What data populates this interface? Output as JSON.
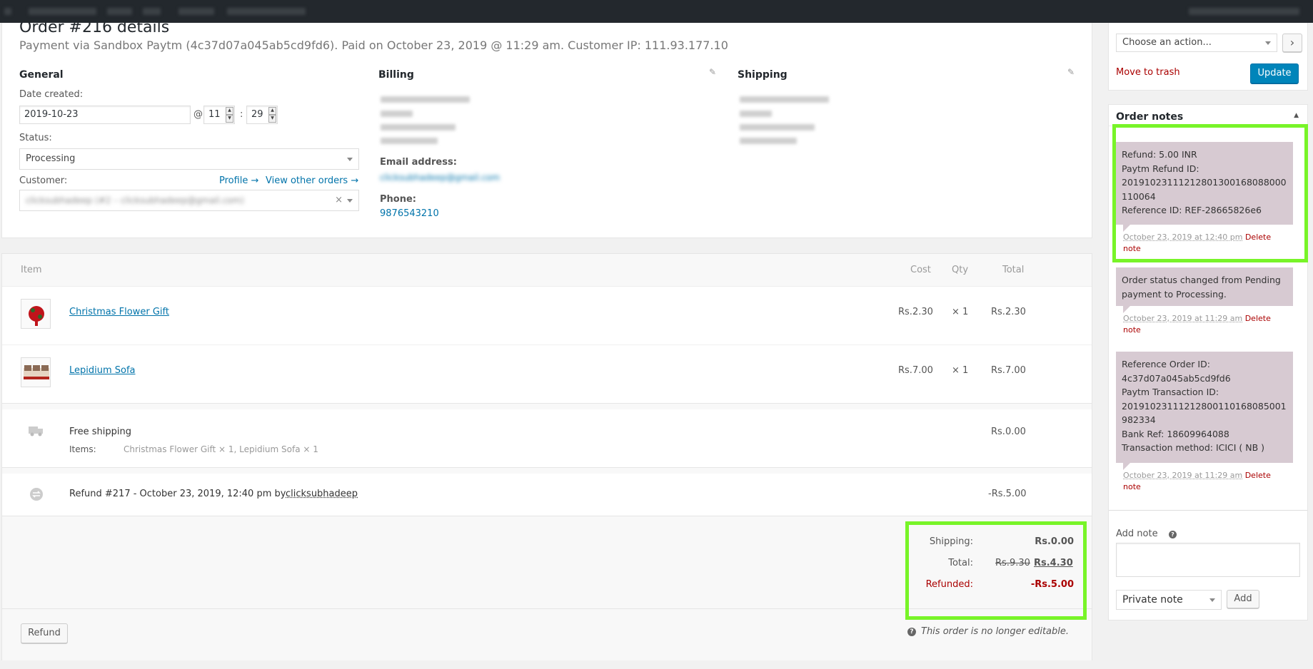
{
  "order": {
    "title": "Order #216 details",
    "subtitle": "Payment via Sandbox Paytm (4c37d07a045ab5cd9fd6). Paid on October 23, 2019 @ 11:29 am. Customer IP: 111.93.177.10"
  },
  "general": {
    "heading": "General",
    "date_label": "Date created:",
    "date_value": "2019-10-23",
    "at": "@",
    "hour": "11",
    "colon": ":",
    "minute": "29",
    "status_label": "Status:",
    "status_value": "Processing",
    "customer_label": "Customer:",
    "profile_link": "Profile →",
    "other_orders_link": "View other orders →",
    "customer_value": "clicksubhadeep (#2 – clicksubhadeep@gmail.com)"
  },
  "billing": {
    "heading": "Billing",
    "email_label": "Email address:",
    "email_value": "clicksubhadeep@gmail.com",
    "phone_label": "Phone:",
    "phone_value": "9876543210"
  },
  "shipping_col": {
    "heading": "Shipping"
  },
  "items": {
    "headers": {
      "item": "Item",
      "cost": "Cost",
      "qty": "Qty",
      "total": "Total"
    },
    "rows": [
      {
        "name": "Christmas Flower Gift",
        "cost": "Rs.2.30",
        "qty": "× 1",
        "total": "Rs.2.30"
      },
      {
        "name": "Lepidium Sofa",
        "cost": "Rs.7.00",
        "qty": "× 1",
        "total": "Rs.7.00"
      }
    ],
    "shipping": {
      "method": "Free shipping",
      "items_label": "Items:",
      "items_value": "Christmas Flower Gift × 1, Lepidium Sofa × 1",
      "total": "Rs.0.00"
    },
    "refund": {
      "text": "Refund #217 - October 23, 2019, 12:40 pm by",
      "user": "clicksubhadeep",
      "amount": "-Rs.5.00"
    }
  },
  "totals": {
    "shipping_label": "Shipping:",
    "shipping_value": "Rs.0.00",
    "total_label": "Total:",
    "total_old": "Rs.9.30",
    "total_new": "Rs.4.30",
    "refunded_label": "Refunded:",
    "refunded_value": "-Rs.5.00"
  },
  "footer": {
    "refund_button": "Refund",
    "not_editable": "This order is no longer editable."
  },
  "actions": {
    "select_value": "Choose an action...",
    "go": "›",
    "trash": "Move to trash",
    "update": "Update"
  },
  "notes": {
    "heading": "Order notes",
    "list": [
      {
        "lines": [
          "Refund: 5.00 INR",
          "Paytm Refund ID:",
          "20191023111212801300168088000",
          "110064",
          "Reference ID: REF-28665826e6"
        ],
        "date": "October 23, 2019 at 12:40 pm",
        "delete": "Delete",
        "delete2": "note"
      },
      {
        "lines": [
          "Order status changed from Pending",
          "payment to Processing."
        ],
        "date": "October 23, 2019 at 11:29 am",
        "delete": "Delete",
        "delete2": "note"
      },
      {
        "lines": [
          "Reference Order ID:",
          "4c37d07a045ab5cd9fd6",
          "Paytm Transaction ID:",
          "20191023111212800110168085001",
          "982334",
          "Bank Ref: 18609964088",
          "Transaction method: ICICI ( NB )"
        ],
        "date": "October 23, 2019 at 11:29 am",
        "delete": "Delete",
        "delete2": "note"
      }
    ],
    "add_label": "Add note",
    "help_icon": "?",
    "type_value": "Private note",
    "add_button": "Add"
  },
  "colors": {
    "accent": "#0085ba",
    "highlight": "#78f428",
    "note_bg": "#d7cad2",
    "refund": "#aa0000"
  }
}
